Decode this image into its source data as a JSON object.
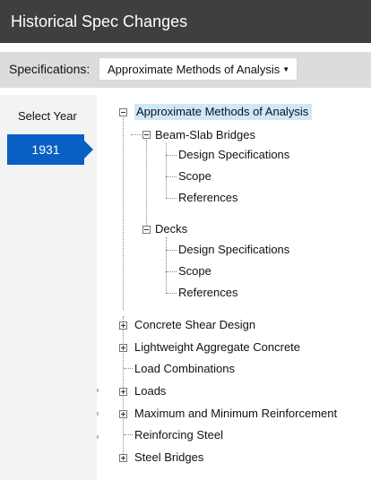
{
  "header": {
    "title": "Historical Spec Changes"
  },
  "spec_bar": {
    "label": "Specifications:",
    "selected": "Approximate Methods of Analysis"
  },
  "year_panel": {
    "label": "Select Year",
    "selected_year": "1931"
  },
  "tree": {
    "root": "Approximate Methods of Analysis",
    "beam_slab": "Beam-Slab Bridges",
    "beam_slab_children": [
      "Design Specifications",
      "Scope",
      "References"
    ],
    "decks": "Decks",
    "decks_children": [
      "Design Specifications",
      "Scope",
      "References"
    ],
    "siblings": [
      "Concrete Shear Design",
      "Lightweight Aggregate Concrete",
      "Load Combinations",
      "Loads",
      "Maximum and Minimum Reinforcement",
      "Reinforcing Steel",
      "Steel Bridges"
    ]
  },
  "colors": {
    "header_bg": "#3f3f3f",
    "year_button": "#0a5fc5",
    "selection": "#cde8fb"
  },
  "icons": [
    "expand-minus-icon",
    "expand-plus-icon"
  ]
}
